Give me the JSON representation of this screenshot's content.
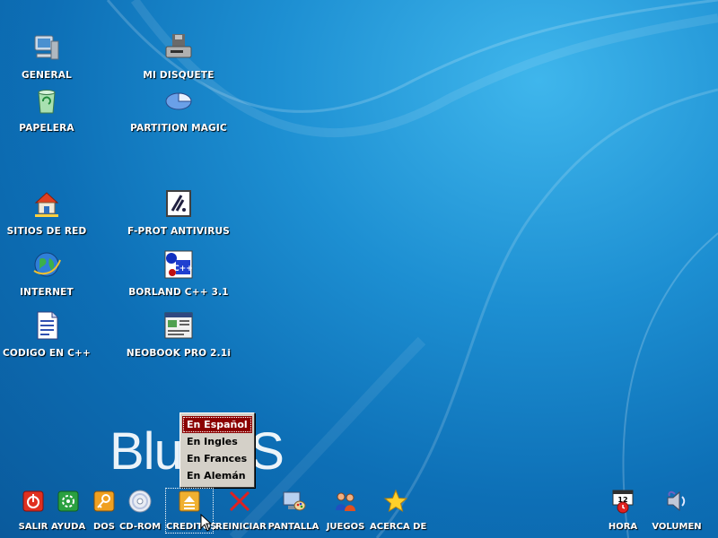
{
  "desktop": {
    "icons": [
      {
        "label": "GENERAL",
        "icon": "computer-icon"
      },
      {
        "label": "MI DISQUETE",
        "icon": "floppy-drive-icon"
      },
      {
        "label": "PAPELERA",
        "icon": "recycle-bin-icon"
      },
      {
        "label": "PARTITION MAGIC",
        "icon": "partition-pie-icon"
      },
      {
        "label": "SITIOS DE RED",
        "icon": "network-house-icon"
      },
      {
        "label": "F-PROT ANTIVIRUS",
        "icon": "antivirus-icon"
      },
      {
        "label": "INTERNET",
        "icon": "globe-icon"
      },
      {
        "label": "BORLAND C++ 3.1",
        "icon": "cpp-icon"
      },
      {
        "label": "CODIGO EN C++",
        "icon": "document-icon"
      },
      {
        "label": "NEOBOOK PRO 2.1i",
        "icon": "window-app-icon"
      }
    ]
  },
  "logo": {
    "text": "BlueOS"
  },
  "popup_menu": {
    "items": [
      "En Español",
      "En Ingles",
      "En Frances",
      "En Alemán"
    ],
    "selected_index": 0
  },
  "taskbar": {
    "left": [
      {
        "label": "SALIR",
        "icon": "power-icon"
      },
      {
        "label": "AYUDA",
        "icon": "help-icon"
      },
      {
        "label": "DOS",
        "icon": "dos-key-icon"
      },
      {
        "label": "CD-ROM",
        "icon": "cd-icon"
      },
      {
        "label": "CREDITOS",
        "icon": "eject-icon"
      },
      {
        "label": "REINICIAR",
        "icon": "restart-x-icon"
      },
      {
        "label": "PANTALLA",
        "icon": "display-paint-icon"
      },
      {
        "label": "JUEGOS",
        "icon": "games-people-icon"
      },
      {
        "label": "ACERCA DE",
        "icon": "star-icon"
      }
    ],
    "right": [
      {
        "label": "HORA",
        "icon": "clock-calendar-icon"
      },
      {
        "label": "VOLUMEN",
        "icon": "speaker-icon"
      }
    ]
  },
  "colors": {
    "menu_selection": "#8b0000",
    "desktop_blue": "#1d8fd2"
  }
}
